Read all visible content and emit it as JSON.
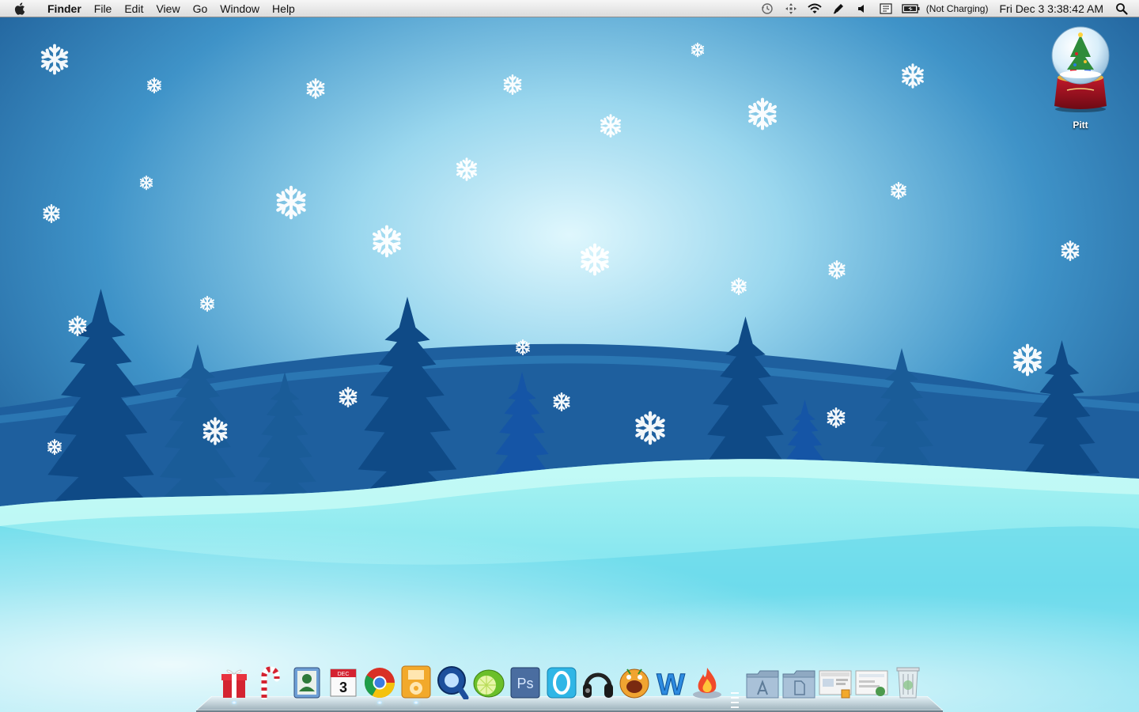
{
  "menubar": {
    "apple_icon": "apple-logo-icon",
    "app_name": "Finder",
    "menus": [
      "File",
      "Edit",
      "View",
      "Go",
      "Window",
      "Help"
    ],
    "status_icons": [
      "time-machine-icon",
      "spaces-icon",
      "wifi-icon",
      "ink-pen-icon",
      "volume-icon",
      "input-menu-icon",
      "battery-icon"
    ],
    "battery_status": "(Not Charging)",
    "clock": "Fri Dec 3  3:38:42 AM",
    "spotlight_icon": "spotlight-search-icon"
  },
  "desktop": {
    "wallpaper": "christmas-snowy-forest",
    "icon": {
      "label": "Pitt",
      "icon": "snow-globe-drive-icon"
    }
  },
  "dock": {
    "apps": [
      {
        "name": "gift-icon",
        "running": true
      },
      {
        "name": "candy-cane-icon",
        "running": false
      },
      {
        "name": "address-book-icon",
        "running": false
      },
      {
        "name": "ical-icon",
        "running": false,
        "month": "DEC",
        "day": "3"
      },
      {
        "name": "chrome-icon",
        "running": true
      },
      {
        "name": "ipod-icon",
        "running": true
      },
      {
        "name": "quicktime-icon",
        "running": false
      },
      {
        "name": "lime-icon",
        "running": false
      },
      {
        "name": "photoshop-icon",
        "running": false,
        "text": "Ps"
      },
      {
        "name": "opera-icon",
        "running": false
      },
      {
        "name": "headphones-icon",
        "running": false
      },
      {
        "name": "adium-icon",
        "running": false
      },
      {
        "name": "word-icon",
        "running": false,
        "text": "W"
      },
      {
        "name": "burn-icon",
        "running": false
      }
    ],
    "stacks": [
      {
        "name": "applications-folder-icon"
      },
      {
        "name": "documents-folder-icon"
      },
      {
        "name": "screenshot-stack-icon"
      },
      {
        "name": "downloads-stack-icon"
      },
      {
        "name": "trash-icon"
      }
    ],
    "colors": {
      "shelf": "#c9d6de",
      "running": "#bfefff"
    }
  }
}
